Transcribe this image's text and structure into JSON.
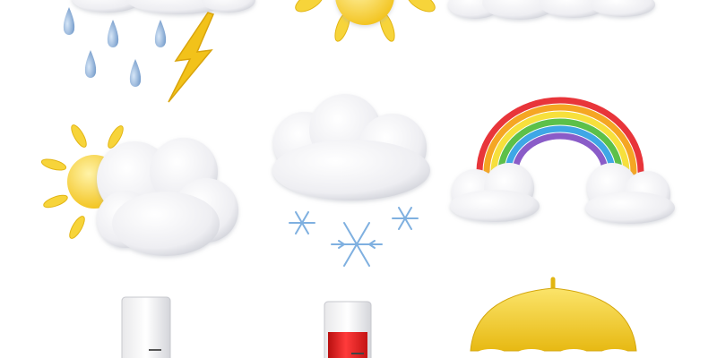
{
  "scene": {
    "background": "#ffffff",
    "icons": [
      {
        "name": "rain-lightning-icon",
        "row": 1,
        "col": 1
      },
      {
        "name": "sun-icon",
        "row": 1,
        "col": 2
      },
      {
        "name": "clouds-icon",
        "row": 1,
        "col": 3
      },
      {
        "name": "partly-cloudy-icon",
        "row": 2,
        "col": 1
      },
      {
        "name": "snow-cloud-icon",
        "row": 2,
        "col": 2
      },
      {
        "name": "rainbow-icon",
        "row": 2,
        "col": 3
      },
      {
        "name": "thermometer-cold-icon",
        "row": 3,
        "col": 1
      },
      {
        "name": "thermometer-hot-icon",
        "row": 3,
        "col": 2
      },
      {
        "name": "umbrella-icon",
        "row": 3,
        "col": 3
      }
    ],
    "colors": {
      "cloud": "#f4f4f6",
      "cloud_shade": "#c9cbd3",
      "raindrop": "#8fb3dc",
      "lightning": "#f2c21a",
      "sun": "#f7d43a",
      "snowflake": "#7fb0e0",
      "thermo_hot": "#e21b1b",
      "umbrella": "#f3cf2c",
      "rainbow": [
        "#e8353a",
        "#f5a623",
        "#f7e03c",
        "#5cc04a",
        "#3fa7e6",
        "#8a5cc8"
      ]
    },
    "thermometers": {
      "cold_level": 0.0,
      "hot_level": 0.6
    }
  }
}
